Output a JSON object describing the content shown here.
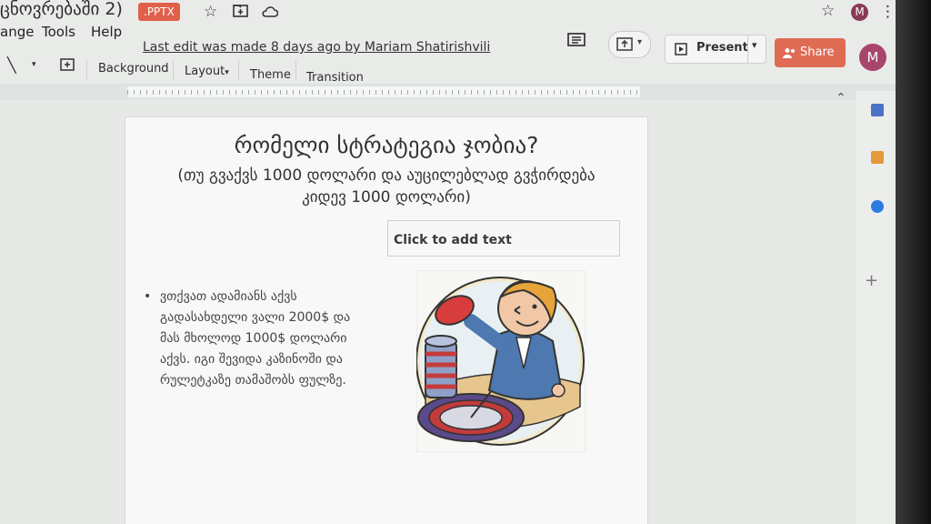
{
  "title_bar": {
    "doc_title": "ცნოვრებაში 2)",
    "format_badge": ".PPTX"
  },
  "menu": {
    "items": [
      "ange",
      "Tools",
      "Help"
    ],
    "last_edit": "Last edit was made 8 days ago by Mariam Shatirishvili"
  },
  "header_actions": {
    "present_label": "Present",
    "share_label": "Share",
    "avatar_initial": "M"
  },
  "toolbar": {
    "background_label": "Background",
    "layout_label": "Layout",
    "theme_label": "Theme",
    "transition_label": "Transition"
  },
  "slide": {
    "title": "რომელი სტრატეგია ჯობია?",
    "subtitle": "(თუ გვაქვს 1000 დოლარი და აუცილებლად გვჭირდება კიდევ 1000 დოლარი)",
    "placeholder": "Click to add text",
    "bullet": "ვთქვათ ადამიანს აქვს გადასახდელი ვალი 2000$ და მას მხოლოდ 1000$ დოლარი აქვს. იგი შევიდა კაზინოში და რულეტკაზე თამაშობს ფულზე."
  },
  "colors": {
    "share_button": "#df6b55",
    "badge": "#e0604a",
    "avatar": "#a8456a"
  }
}
